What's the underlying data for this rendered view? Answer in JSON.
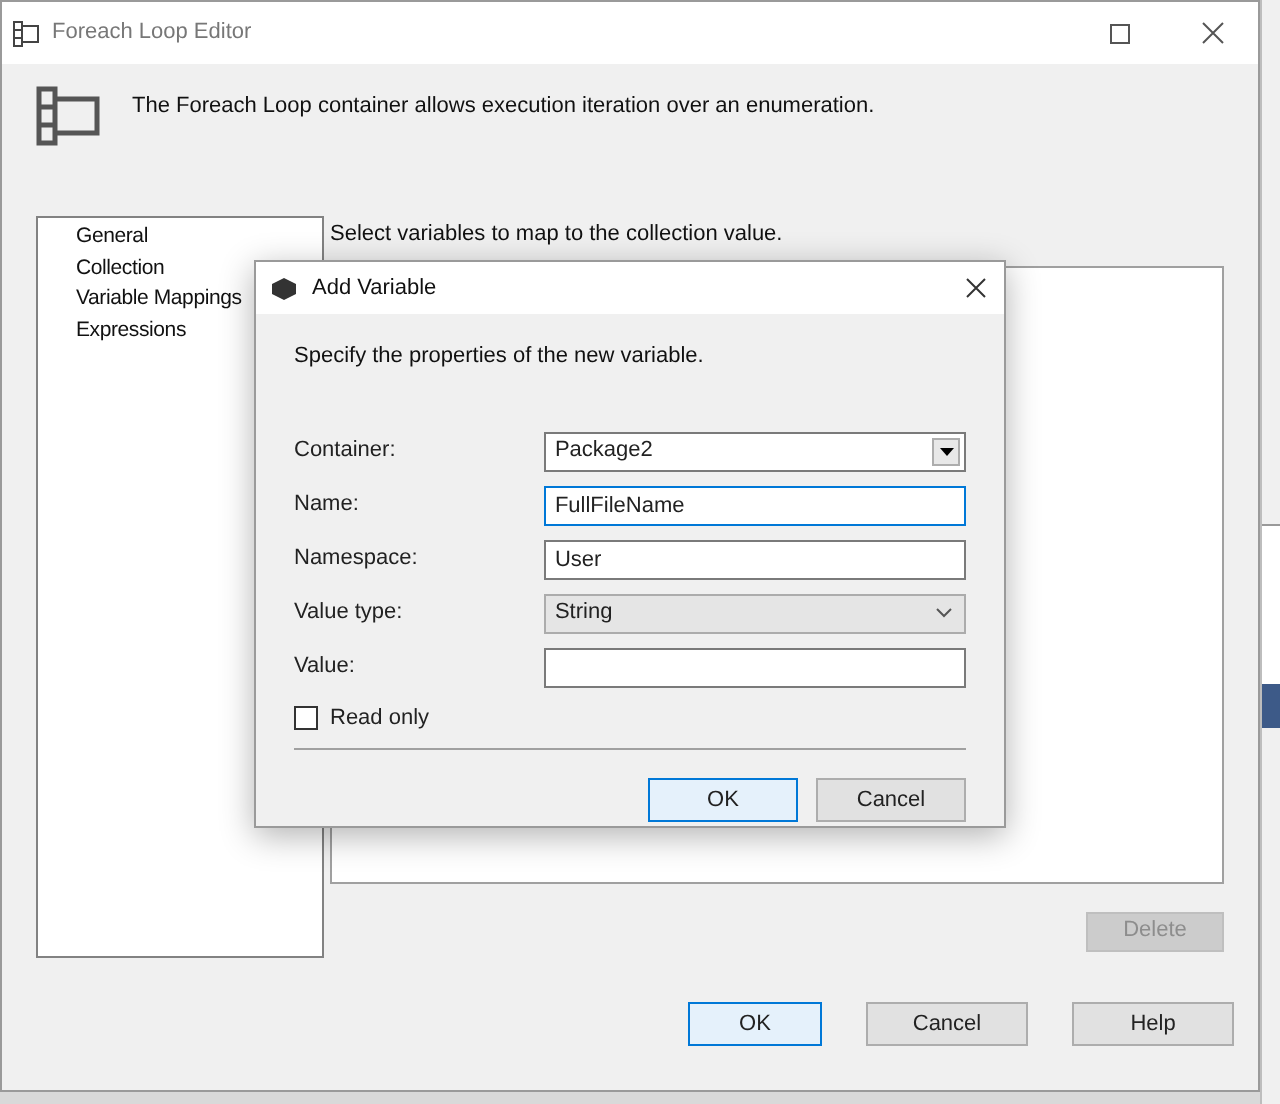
{
  "window": {
    "title": "Foreach Loop Editor",
    "description": "The Foreach Loop container allows execution iteration over an enumeration."
  },
  "nav": {
    "items": [
      {
        "label": "General"
      },
      {
        "label": "Collection"
      },
      {
        "label": "Variable Mappings"
      },
      {
        "label": "Expressions"
      }
    ]
  },
  "mappings": {
    "caption": "Select variables to map to the collection value.",
    "delete_button": {
      "label": "Delete",
      "disabled": true
    }
  },
  "buttons": [
    {
      "label": "OK",
      "default": true
    },
    {
      "label": "Cancel",
      "default": false
    },
    {
      "label": "Help",
      "default": false
    }
  ],
  "dialog": {
    "title": "Add Variable",
    "instructions": "Specify the properties of the new variable.",
    "fields": [
      {
        "kind": "combo",
        "label": "Container:",
        "value": "Package2",
        "focused": false
      },
      {
        "kind": "text",
        "label": "Name:",
        "value": "FullFileName",
        "focused": true
      },
      {
        "kind": "text",
        "label": "Namespace:",
        "value": "User",
        "focused": false
      },
      {
        "kind": "dropdown",
        "label": "Value type:",
        "value": "String",
        "focused": false
      },
      {
        "kind": "text",
        "label": "Value:",
        "focused": false
      }
    ],
    "read_only": {
      "label": "Read only",
      "checked": false
    },
    "buttons": [
      {
        "label": "OK",
        "default": true
      },
      {
        "label": "Cancel",
        "default": false
      }
    ]
  }
}
